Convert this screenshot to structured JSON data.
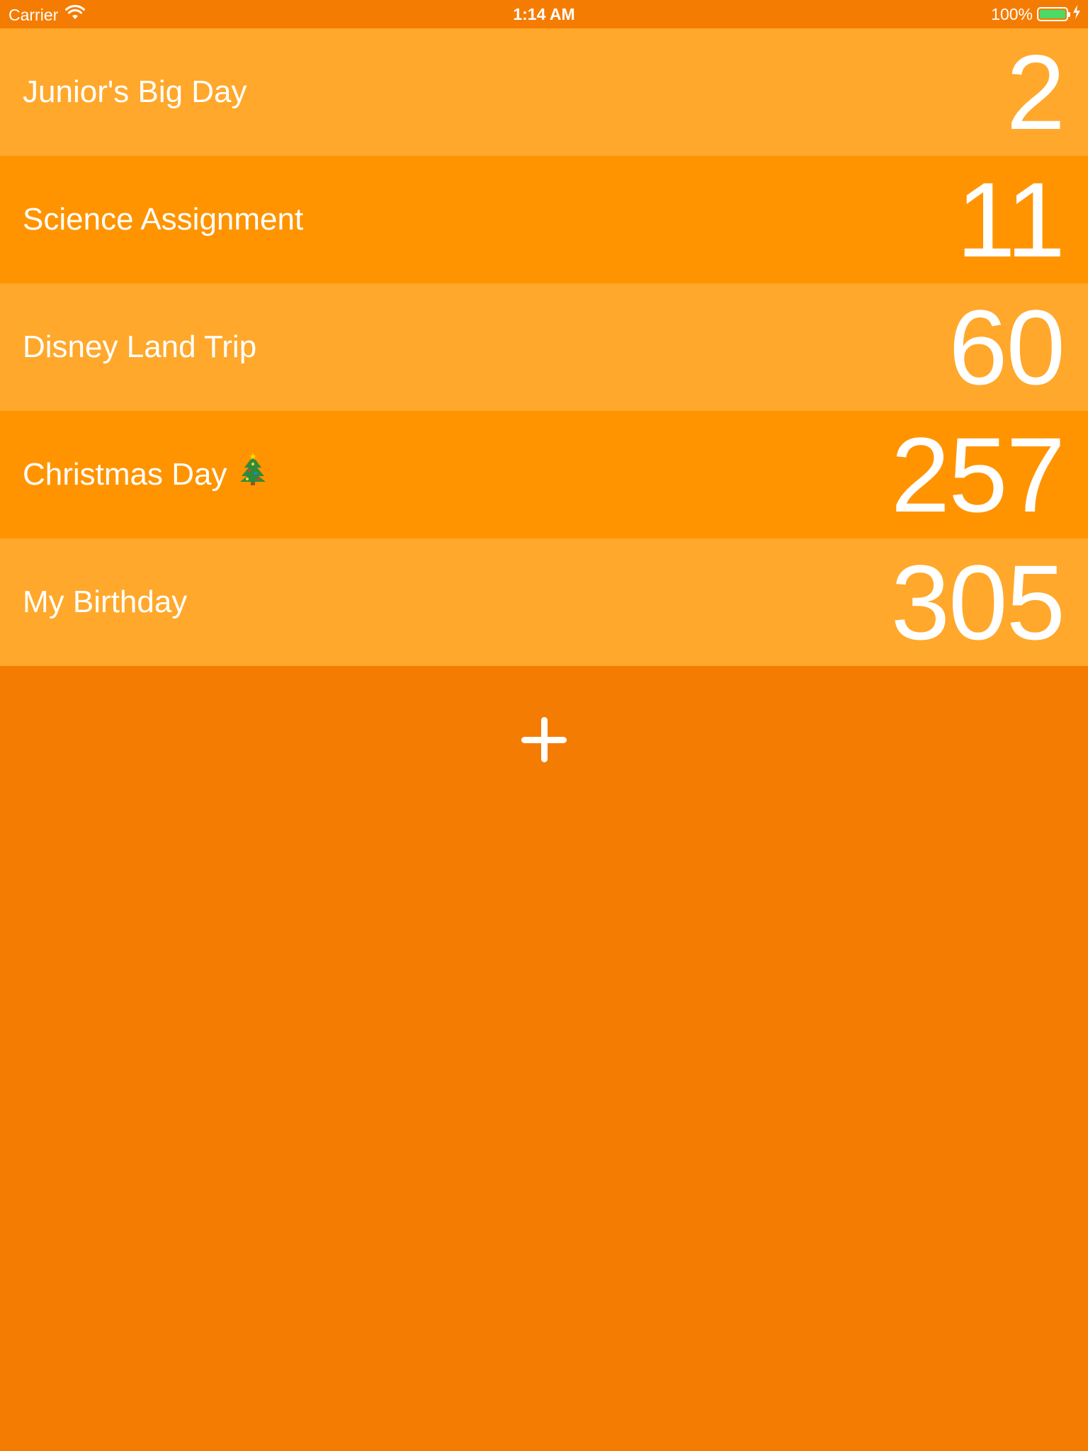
{
  "status_bar": {
    "carrier": "Carrier",
    "wifi_icon": "wifi-icon",
    "time": "1:14 AM",
    "battery_percent": "100%",
    "battery_level": 1.0,
    "battery_icon": "battery-icon",
    "charging_icon": "charging-bolt-icon"
  },
  "colors": {
    "background": "#f57c02",
    "row_light": "#ffa82b",
    "row_dark": "#ff9400",
    "text": "#ffffff",
    "battery_fill": "#4cd964"
  },
  "events": [
    {
      "title": "Junior's Big Day",
      "count": "2"
    },
    {
      "title": "Science Assignment",
      "count": "11"
    },
    {
      "title": "Disney Land Trip",
      "count": "60"
    },
    {
      "title": "Christmas Day",
      "count": "257",
      "icon": "christmas-tree-icon"
    },
    {
      "title": "My Birthday",
      "count": "305"
    }
  ],
  "add_button": {
    "icon": "plus-icon"
  }
}
